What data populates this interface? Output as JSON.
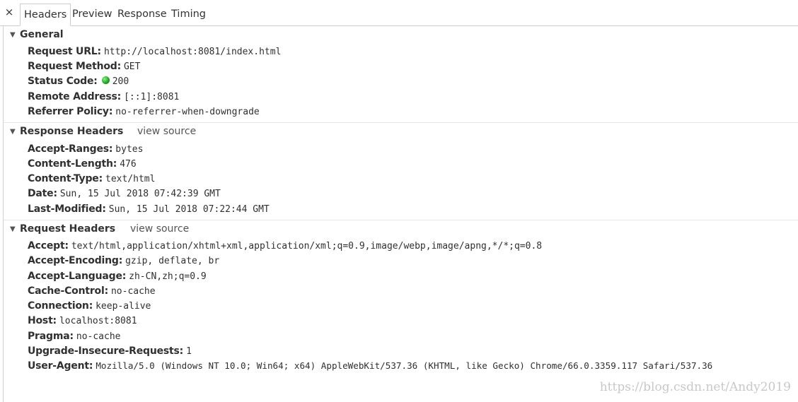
{
  "tabbar": {
    "close_label": "×",
    "tabs": [
      {
        "label": "Headers",
        "active": true
      },
      {
        "label": "Preview",
        "active": false
      },
      {
        "label": "Response",
        "active": false
      },
      {
        "label": "Timing",
        "active": false
      }
    ]
  },
  "general": {
    "title": "General",
    "rows": [
      {
        "key": "Request URL:",
        "value": "http://localhost:8081/index.html"
      },
      {
        "key": "Request Method:",
        "value": "GET"
      },
      {
        "key": "Status Code:",
        "value": "200",
        "status_color": "#16a31c"
      },
      {
        "key": "Remote Address:",
        "value": "[::1]:8081"
      },
      {
        "key": "Referrer Policy:",
        "value": "no-referrer-when-downgrade"
      }
    ]
  },
  "response_headers": {
    "title": "Response Headers",
    "view_source": "view source",
    "rows": [
      {
        "key": "Accept-Ranges:",
        "value": "bytes"
      },
      {
        "key": "Content-Length:",
        "value": "476"
      },
      {
        "key": "Content-Type:",
        "value": "text/html"
      },
      {
        "key": "Date:",
        "value": "Sun, 15 Jul 2018 07:42:39 GMT"
      },
      {
        "key": "Last-Modified:",
        "value": "Sun, 15 Jul 2018 07:22:44 GMT"
      }
    ]
  },
  "request_headers": {
    "title": "Request Headers",
    "view_source": "view source",
    "rows": [
      {
        "key": "Accept:",
        "value": "text/html,application/xhtml+xml,application/xml;q=0.9,image/webp,image/apng,*/*;q=0.8"
      },
      {
        "key": "Accept-Encoding:",
        "value": "gzip, deflate, br"
      },
      {
        "key": "Accept-Language:",
        "value": "zh-CN,zh;q=0.9"
      },
      {
        "key": "Cache-Control:",
        "value": "no-cache"
      },
      {
        "key": "Connection:",
        "value": "keep-alive"
      },
      {
        "key": "Host:",
        "value": "localhost:8081"
      },
      {
        "key": "Pragma:",
        "value": "no-cache"
      },
      {
        "key": "Upgrade-Insecure-Requests:",
        "value": "1"
      },
      {
        "key": "User-Agent:",
        "value": "Mozilla/5.0 (Windows NT 10.0; Win64; x64) AppleWebKit/537.36 (KHTML, like Gecko) Chrome/66.0.3359.117 Safari/537.36"
      }
    ]
  },
  "watermark": "https://blog.csdn.net/Andy2019"
}
